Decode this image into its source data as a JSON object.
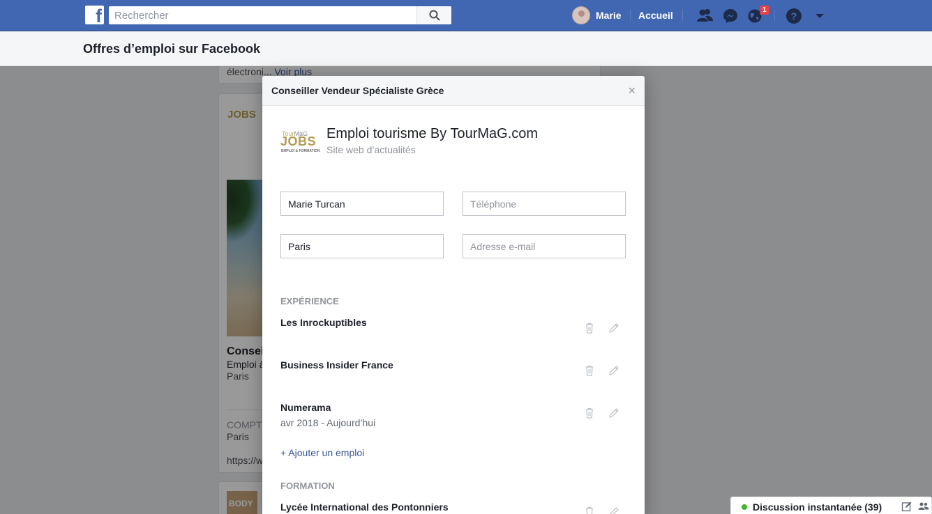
{
  "topbar": {
    "search_placeholder": "Rechercher",
    "user_name": "Marie",
    "home_label": "Accueil",
    "notifications_count": "1"
  },
  "page": {
    "title": "Offres d’emploi sur Facebook"
  },
  "feed": {
    "snippet": "électroni...",
    "see_more": "Voir plus",
    "job_title": "Consei",
    "job_sub": "Emploi à",
    "job_city": "Paris",
    "company_prefix": "COMPTO",
    "company_city": "Paris",
    "url_prefix": "https://w",
    "logo_mini": "JOBS",
    "logo_mini_2": "BODY"
  },
  "modal": {
    "title": "Conseiller Vendeur Spécialiste Grèce",
    "close": "×",
    "company_logo": {
      "top_a": "Tour",
      "top_b": "MaG",
      "main": "JOBS",
      "bottom": "EMPLOI & FORMATION"
    },
    "company_name": "Emploi tourisme By TourMaG.com",
    "company_category": "Site web d’actualités",
    "fields": {
      "name_value": "Marie Turcan",
      "phone_placeholder": "Téléphone",
      "city_value": "Paris",
      "email_placeholder": "Adresse e-mail"
    },
    "experience_heading": "EXPÉRIENCE",
    "experiences": [
      {
        "title": "Les Inrockuptibles",
        "date": ""
      },
      {
        "title": "Business Insider France",
        "date": ""
      },
      {
        "title": "Numerama",
        "date": "avr 2018 - Aujourd’hui"
      }
    ],
    "add_job": "+ Ajouter un emploi",
    "education_heading": "FORMATION",
    "education": [
      {
        "title": "Lycée International des Pontonniers"
      }
    ]
  },
  "chat": {
    "label": "Discussion instantanée (39)"
  },
  "colors": {
    "brand_blue": "#4267b2",
    "link_blue": "#385898",
    "online_green": "#42b72a",
    "badge_red": "#fa3e3e"
  },
  "icons": [
    "facebook-logo-icon",
    "search-icon",
    "friends-icon",
    "messenger-icon",
    "globe-notifications-icon",
    "help-icon",
    "caret-down-icon",
    "trash-icon",
    "pencil-icon",
    "compose-icon",
    "chat-settings-icon"
  ]
}
